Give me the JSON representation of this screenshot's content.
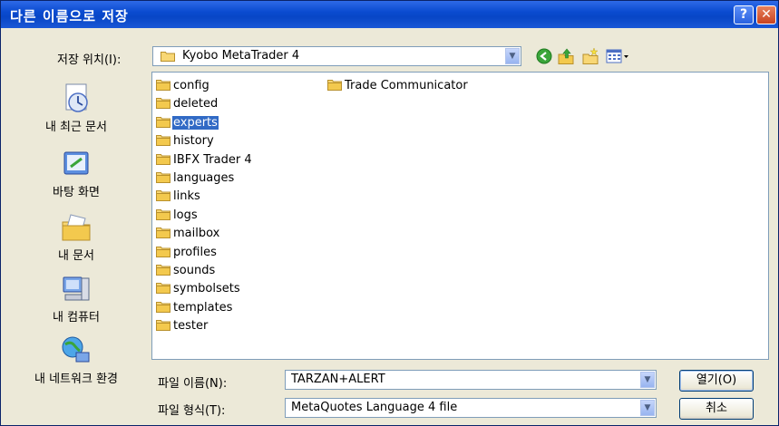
{
  "window": {
    "title": "다른 이름으로 저장",
    "help_label": "?",
    "close_label": "✕"
  },
  "location": {
    "label": "저장 위치(I):",
    "value": "Kyobo MetaTrader 4"
  },
  "toolbar": [
    "back-icon",
    "up-folder-icon",
    "new-folder-icon",
    "view-menu-icon"
  ],
  "places": [
    {
      "label": "내 최근 문서",
      "icon": "recent-documents-icon"
    },
    {
      "label": "바탕 화면",
      "icon": "desktop-icon"
    },
    {
      "label": "내 문서",
      "icon": "my-documents-icon"
    },
    {
      "label": "내 컴퓨터",
      "icon": "my-computer-icon"
    },
    {
      "label": "내 네트워크 환경",
      "icon": "network-places-icon"
    }
  ],
  "files": {
    "col1": [
      "config",
      "deleted",
      "experts",
      "history",
      "IBFX Trader 4",
      "languages",
      "links",
      "logs",
      "mailbox",
      "profiles",
      "sounds",
      "symbolsets",
      "templates",
      "tester"
    ],
    "col2": [
      "Trade Communicator"
    ],
    "selected": "experts"
  },
  "filename": {
    "label": "파일 이름(N):",
    "value": "TARZAN+ALERT"
  },
  "filetype": {
    "label": "파일 형식(T):",
    "value": "MetaQuotes Language 4 file"
  },
  "buttons": {
    "open": "열기(O)",
    "cancel": "취소"
  }
}
